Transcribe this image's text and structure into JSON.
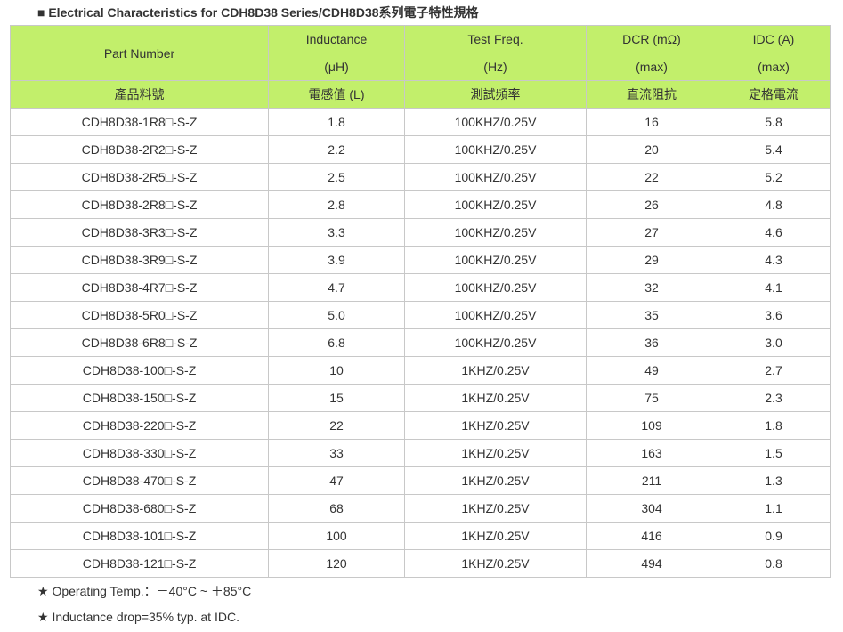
{
  "title": "■ Electrical Characteristics for CDH8D38 Series/CDH8D38系列電子特性規格",
  "colors": {
    "header_bg": "#c2ef6b",
    "border": "#c8c8c8",
    "text": "#333333"
  },
  "table": {
    "header_row1": {
      "part_number": "Part Number",
      "inductance": "Inductance",
      "test_freq": "Test Freq.",
      "dcr": "DCR (mΩ)",
      "idc": "IDC (A)"
    },
    "header_row2": {
      "inductance_unit": "(μH)",
      "test_freq_unit": "(Hz)",
      "dcr_unit": "(max)",
      "idc_unit": "(max)"
    },
    "header_row3": {
      "part_number_zh": "產品料號",
      "inductance_zh": "電感值 (L)",
      "test_freq_zh": "測試頻率",
      "dcr_zh": "直流阻抗",
      "idc_zh": "定格電流"
    },
    "rows": [
      [
        "CDH8D38-1R8□-S-Z",
        "1.8",
        "100KHZ/0.25V",
        "16",
        "5.8"
      ],
      [
        "CDH8D38-2R2□-S-Z",
        "2.2",
        "100KHZ/0.25V",
        "20",
        "5.4"
      ],
      [
        "CDH8D38-2R5□-S-Z",
        "2.5",
        "100KHZ/0.25V",
        "22",
        "5.2"
      ],
      [
        "CDH8D38-2R8□-S-Z",
        "2.8",
        "100KHZ/0.25V",
        "26",
        "4.8"
      ],
      [
        "CDH8D38-3R3□-S-Z",
        "3.3",
        "100KHZ/0.25V",
        "27",
        "4.6"
      ],
      [
        "CDH8D38-3R9□-S-Z",
        "3.9",
        "100KHZ/0.25V",
        "29",
        "4.3"
      ],
      [
        "CDH8D38-4R7□-S-Z",
        "4.7",
        "100KHZ/0.25V",
        "32",
        "4.1"
      ],
      [
        "CDH8D38-5R0□-S-Z",
        "5.0",
        "100KHZ/0.25V",
        "35",
        "3.6"
      ],
      [
        "CDH8D38-6R8□-S-Z",
        "6.8",
        "100KHZ/0.25V",
        "36",
        "3.0"
      ],
      [
        "CDH8D38-100□-S-Z",
        "10",
        "1KHZ/0.25V",
        "49",
        "2.7"
      ],
      [
        "CDH8D38-150□-S-Z",
        "15",
        "1KHZ/0.25V",
        "75",
        "2.3"
      ],
      [
        "CDH8D38-220□-S-Z",
        "22",
        "1KHZ/0.25V",
        "109",
        "1.8"
      ],
      [
        "CDH8D38-330□-S-Z",
        "33",
        "1KHZ/0.25V",
        "163",
        "1.5"
      ],
      [
        "CDH8D38-470□-S-Z",
        "47",
        "1KHZ/0.25V",
        "211",
        "1.3"
      ],
      [
        "CDH8D38-680□-S-Z",
        "68",
        "1KHZ/0.25V",
        "304",
        "1.1"
      ],
      [
        "CDH8D38-101□-S-Z",
        "100",
        "1KHZ/0.25V",
        "416",
        "0.9"
      ],
      [
        "CDH8D38-121□-S-Z",
        "120",
        "1KHZ/0.25V",
        "494",
        "0.8"
      ]
    ]
  },
  "notes": [
    "★ Operating Temp.：－40°C ~ ＋85°C",
    "★ Inductance drop=35% typ. at IDC."
  ]
}
